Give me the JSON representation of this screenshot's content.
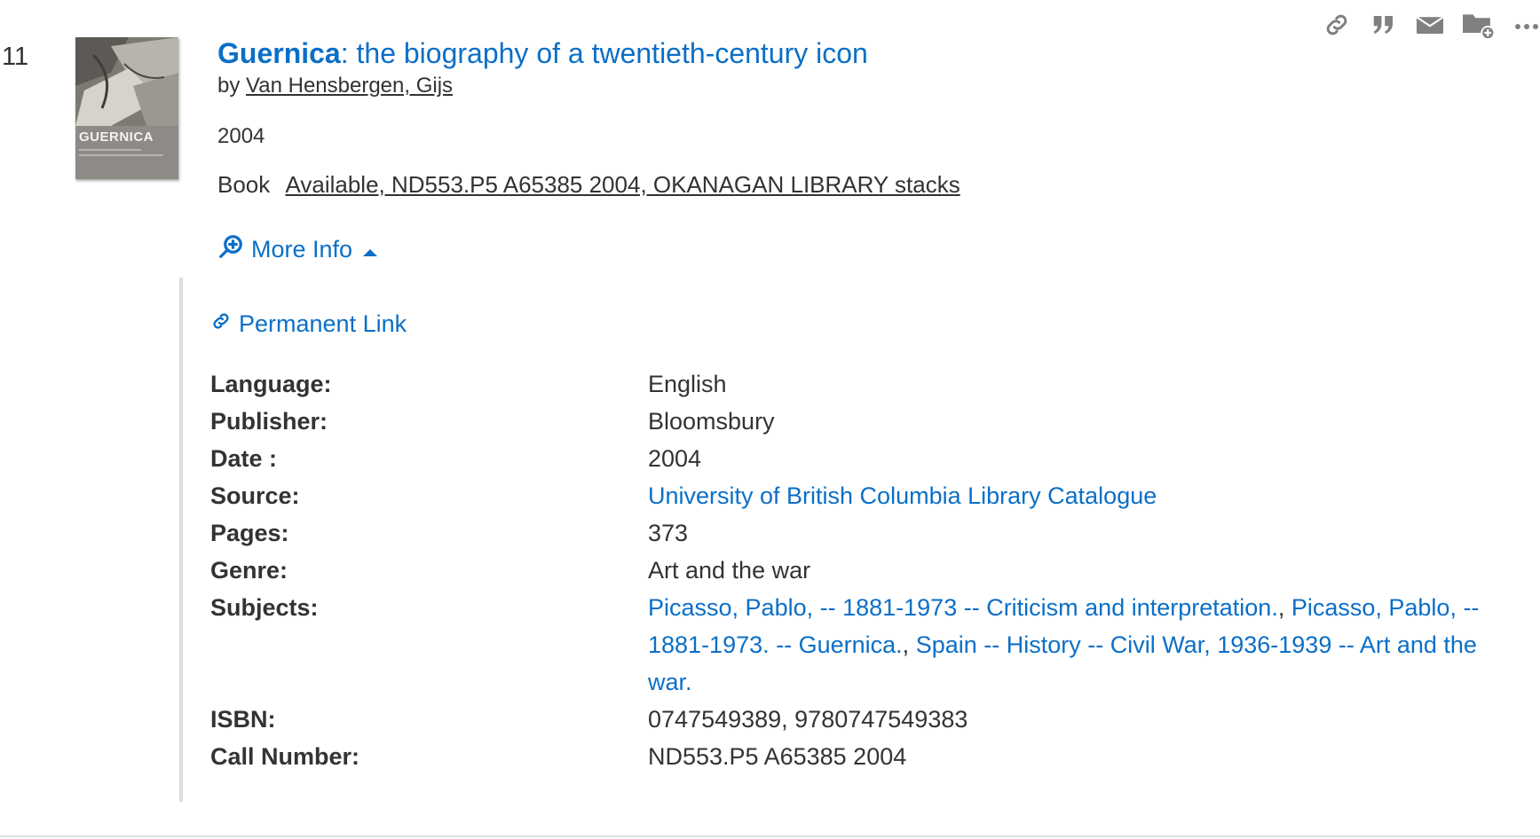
{
  "record": {
    "number": "11",
    "cover_text": "GUERNICA",
    "title_main": "Guernica",
    "title_rest": ": the biography of a twentieth-century icon",
    "author_prefix": "by",
    "author": "Van Hensbergen, Gijs",
    "year": "2004",
    "format": "Book",
    "availability": "Available, ND553.P5 A65385 2004, OKANAGAN LIBRARY stacks",
    "more_info_label": "More Info"
  },
  "actions": {
    "icons": [
      "link-icon",
      "quote-icon",
      "email-icon",
      "add-to-folder-icon",
      "more-options-icon"
    ]
  },
  "details": {
    "permanent_link_label": "Permanent Link",
    "fields": [
      {
        "label": "Language:",
        "value": "English"
      },
      {
        "label": "Publisher:",
        "value": "Bloomsbury"
      },
      {
        "label": "Date :",
        "value": "2004"
      },
      {
        "label": "Source:",
        "value": "University of British Columbia Library Catalogue"
      },
      {
        "label": "Pages:",
        "value": "373"
      },
      {
        "label": "Genre:",
        "value": "Art and the war"
      },
      {
        "label": "Subjects:",
        "value": ""
      },
      {
        "label": "ISBN:",
        "value": "0747549389, 9780747549383"
      },
      {
        "label": "Call Number:",
        "value": "ND553.P5 A65385 2004"
      }
    ],
    "subjects": [
      "Picasso, Pablo, -- 1881-1973 -- Criticism and interpretation.",
      "Picasso, Pablo, -- 1881-1973. -- Guernica.",
      "Spain -- History -- Civil War, 1936-1939 -- Art and the war."
    ],
    "subject_separator": ", "
  },
  "colors": {
    "link": "#0b6fc7",
    "text": "#333333",
    "icon": "#808080",
    "rule": "#dddddd"
  }
}
